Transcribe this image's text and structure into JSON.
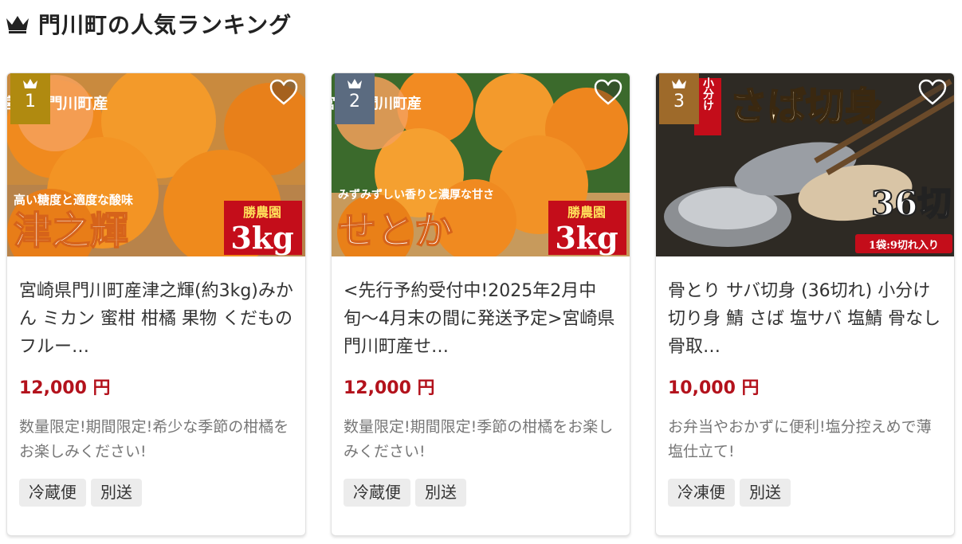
{
  "heading": {
    "title": "門川町の人気ランキング",
    "icon": "crown-icon"
  },
  "colors": {
    "price": "#b3121c",
    "rank_gold": "#b08a10",
    "rank_silver": "#5b6b80",
    "rank_bronze": "#9e6a2a"
  },
  "cards": [
    {
      "rank": "1",
      "image_text": {
        "badge": "宮崎県門川町産",
        "tagline": "高い糖度と適度な酸味",
        "name": "津之輝",
        "farm": "勝農園",
        "weight": "3kg"
      },
      "title": "宮崎県門川町産津之輝(約3kg)みかん ミカン 蜜柑 柑橘 果物 くだもの フルー…",
      "price": "12,000 円",
      "description": "数量限定!期間限定!希少な季節の柑橘をお楽しみください!",
      "tags": [
        "冷蔵便",
        "別送"
      ]
    },
    {
      "rank": "2",
      "image_text": {
        "badge": "宮崎県門川町産",
        "tagline": "みずみずしい香りと濃厚な甘さ",
        "name": "せとか",
        "farm": "勝農園",
        "weight": "3kg"
      },
      "title": "<先行予約受付中!2025年2月中旬〜4月末の間に発送予定>宮崎県門川町産せ…",
      "price": "12,000 円",
      "description": "数量限定!期間限定!季節の柑橘をお楽しみください!",
      "tags": [
        "冷蔵便",
        "別送"
      ]
    },
    {
      "rank": "3",
      "image_text": {
        "badge": "小分け",
        "name": "さば切身",
        "count": "36切",
        "pack": "1袋:9切れ入り"
      },
      "title": "骨とり サバ切身 (36切れ) 小分け 切り身 鯖 さば 塩サバ 塩鯖 骨なし 骨取…",
      "price": "10,000 円",
      "description": "お弁当やおかずに便利!塩分控えめで薄塩仕立て!",
      "tags": [
        "冷凍便",
        "別送"
      ]
    }
  ]
}
